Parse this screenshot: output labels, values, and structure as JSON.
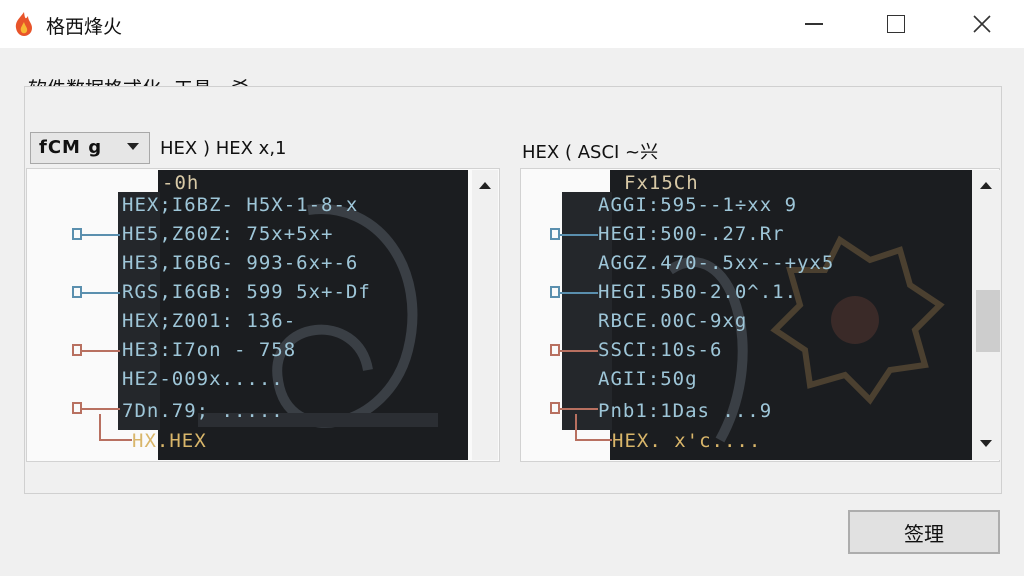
{
  "window": {
    "title": "格西烽火"
  },
  "menu": {
    "text": "软件数据格式化 -工具 - 爻"
  },
  "toolbar": {
    "combo_value": "fCM g",
    "left_label": "HEX ) HEX x,1",
    "right_label": "HEX ( ASCI ~兴"
  },
  "left_terminal": {
    "header": "-0h",
    "rows": [
      "HEX;I6BZ- H5X-1-8-x",
      "HE5,Z60Z: 75x+5x+",
      "HE3,I6BG- 993-6x+-6",
      "RGS,I6GB: 599 5x+-Df",
      "HEX;Z001: 136-",
      "HE3:I7on - 758",
      "HE2-009x.....",
      "7Dn.79; .....",
      "HX.HEX"
    ]
  },
  "right_terminal": {
    "header": "Fx15Ch",
    "rows": [
      "AGGI:595--1÷xx 9",
      "HEGI:500-.27.Rr",
      "AGGZ.470-.5xx--+yx5",
      "HEGI.5B0-2.0^.1.",
      "RBCE.00C-9xg",
      "SSCI:10s-6",
      "AGII:50g",
      "Pnb1:1Das ...9",
      "HEX. x'c...."
    ]
  },
  "buttons": {
    "ok": "签理"
  },
  "colors": {
    "accent": "#9ec6d8",
    "highlight": "#d9b66a",
    "terminal_bg": "#1b1d20"
  },
  "icons": {
    "app": "flame-icon"
  }
}
